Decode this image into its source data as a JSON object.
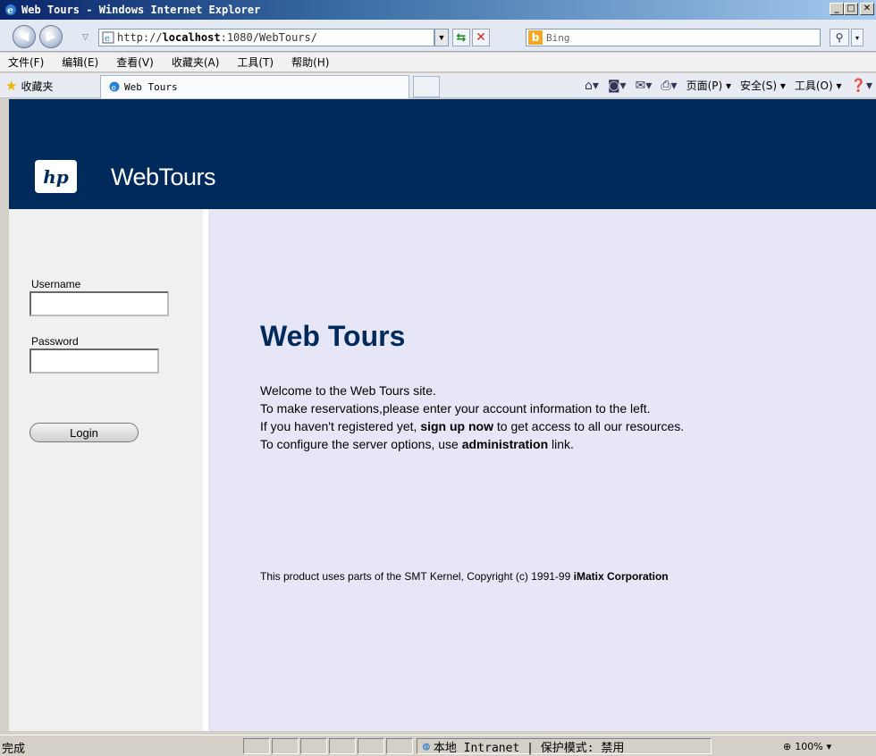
{
  "window": {
    "title": "Web Tours - Windows Internet Explorer",
    "minimize": "_",
    "maximize": "□",
    "close": "✕"
  },
  "address": {
    "url_prefix": "http://",
    "url_host": "localhost",
    "url_rest": ":1080/WebTours/",
    "search_placeholder": "Bing"
  },
  "menu": [
    "文件(F)",
    "编辑(E)",
    "查看(V)",
    "收藏夹(A)",
    "工具(T)",
    "帮助(H)"
  ],
  "favbar": {
    "favorites_label": "收藏夹",
    "tab_title": "Web Tours",
    "page_menu": "页面(P) ▾",
    "safety_menu": "安全(S) ▾",
    "tools_menu": "工具(O) ▾"
  },
  "site": {
    "brand": "WebTours",
    "logo_text": "hp",
    "username_label": "Username",
    "password_label": "Password",
    "login_label": "Login",
    "heading": "Web Tours",
    "line1": "Welcome to the Web Tours site.",
    "line2": "To make reservations,please enter your account information to the left.",
    "line3_a": "If you haven't registered yet, ",
    "line3_link": "sign up now",
    "line3_b": " to get access to all our resources.",
    "line4_a": "To configure the server options, use ",
    "line4_link": "administration",
    "line4_b": " link.",
    "footer_a": "This product uses parts of the SMT Kernel, Copyright (c) 1991-99 ",
    "footer_link": "iMatix Corporation"
  },
  "status": {
    "text": "完成",
    "zone": "本地 Intranet | 保护模式: 禁用",
    "zoom": "100%"
  },
  "colors": {
    "header_bg": "#002a5c",
    "heading_color": "#002a5c",
    "main_bg": "#e6e6f6"
  }
}
